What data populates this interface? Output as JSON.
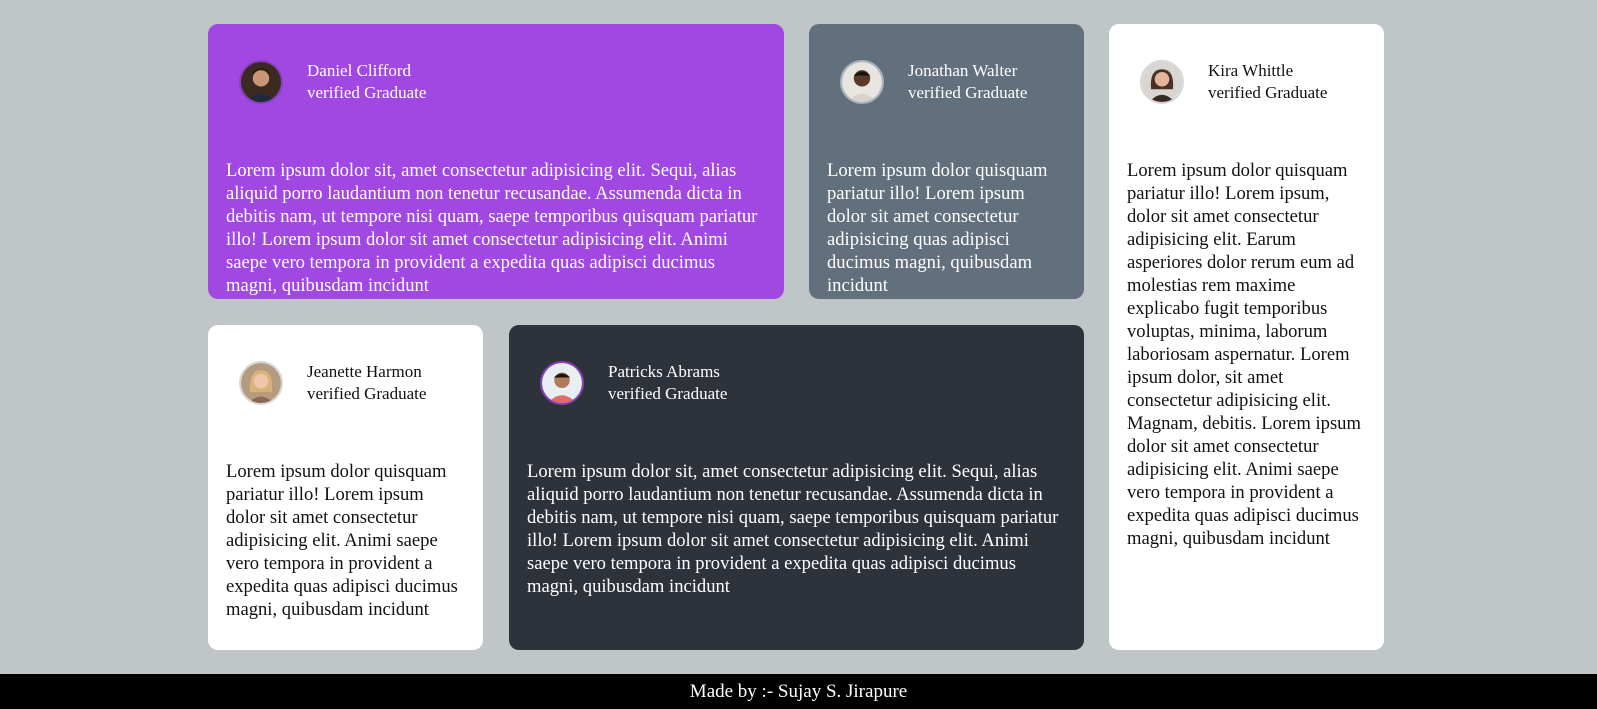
{
  "colors": {
    "page_bg": "#c0c6c8",
    "purple": "#a148e2",
    "gray": "#626f7c",
    "white": "#ffffff",
    "dark": "#2e323a",
    "footer_bg": "#000000"
  },
  "cards": [
    {
      "name": "Daniel Clifford",
      "subtitle": "verified Graduate",
      "text": "Lorem ipsum dolor sit, amet consectetur adipisicing elit. Sequi, alias aliquid porro laudantium non tenetur recusandae. Assumenda dicta in debitis nam, ut tempore nisi quam, saepe temporibus quisquam pariatur illo! Lorem ipsum dolor sit amet consectetur adipisicing elit. Animi saepe vero tempora in provident a expedita quas adipisci ducimus magni, quibusdam incidunt",
      "theme": "purple",
      "avatar": "man-avatar-icon"
    },
    {
      "name": "Jonathan Walter",
      "subtitle": "verified Graduate",
      "text": "Lorem ipsum dolor quisquam pariatur illo! Lorem ipsum dolor sit amet consectetur adipisicing quas adipisci ducimus magni, quibusdam incidunt",
      "theme": "gray",
      "avatar": "man-avatar-icon"
    },
    {
      "name": "Kira Whittle",
      "subtitle": "verified Graduate",
      "text": "Lorem ipsum dolor quisquam pariatur illo! Lorem ipsum, dolor sit amet consectetur adipisicing elit. Earum asperiores dolor rerum eum ad molestias rem maxime explicabo fugit temporibus voluptas, minima, laborum laboriosam aspernatur. Lorem ipsum dolor, sit amet consectetur adipisicing elit. Magnam, debitis. Lorem ipsum dolor sit amet consectetur adipisicing elit. Animi saepe vero tempora in provident a expedita quas adipisci ducimus magni, quibusdam incidunt",
      "theme": "white",
      "avatar": "woman-avatar-icon"
    },
    {
      "name": "Jeanette Harmon",
      "subtitle": "verified Graduate",
      "text": "Lorem ipsum dolor quisquam pariatur illo! Lorem ipsum dolor sit amet consectetur adipisicing elit. Animi saepe vero tempora in provident a expedita quas adipisci ducimus magni, quibusdam incidunt",
      "theme": "white",
      "avatar": "woman-avatar-icon"
    },
    {
      "name": "Patricks Abrams",
      "subtitle": "verified Graduate",
      "text": "Lorem ipsum dolor sit, amet consectetur adipisicing elit. Sequi, alias aliquid porro laudantium non tenetur recusandae. Assumenda dicta in debitis nam, ut tempore nisi quam, saepe temporibus quisquam pariatur illo! Lorem ipsum dolor sit amet consectetur adipisicing elit. Animi saepe vero tempora in provident a expedita quas adipisci ducimus magni, quibusdam incidunt",
      "theme": "dark",
      "avatar": "man-avatar-icon"
    }
  ],
  "footer": {
    "text": "Made by :- Sujay S. Jirapure"
  }
}
